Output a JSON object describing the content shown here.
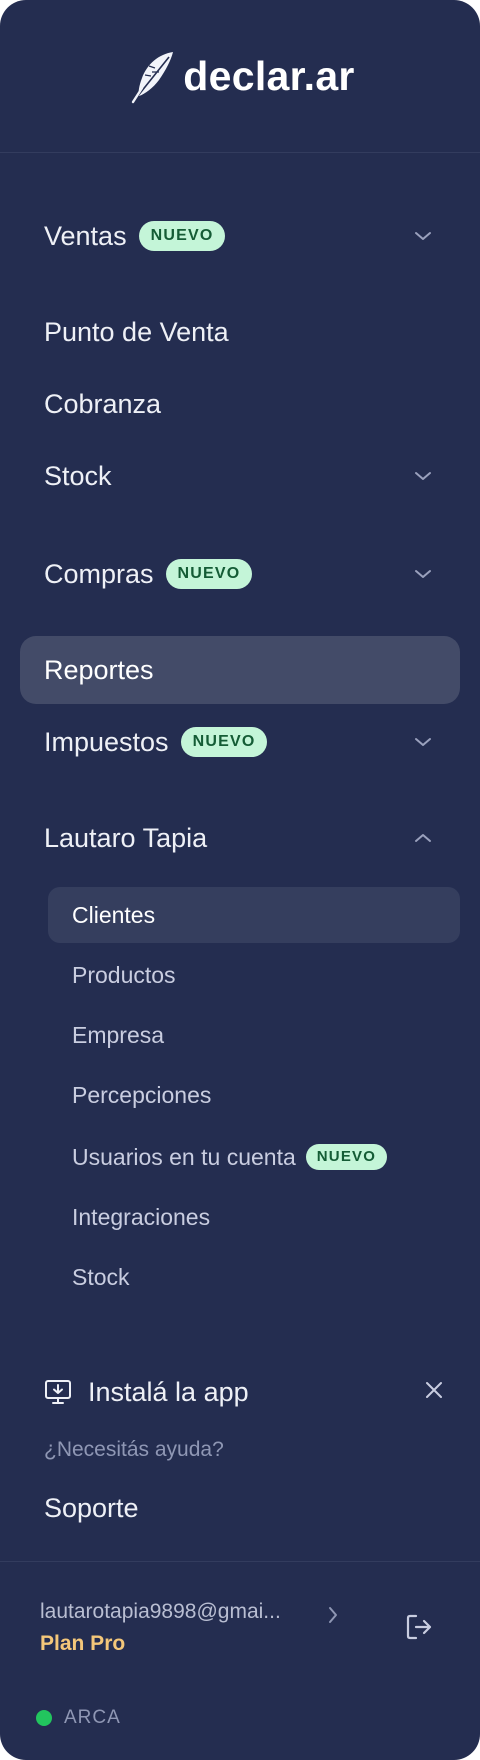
{
  "brand": {
    "name": "declar.ar",
    "logo_icon": "feather-icon"
  },
  "nav": {
    "ventas": {
      "label": "Ventas",
      "badge": "NUEVO"
    },
    "punto_de_venta": {
      "label": "Punto de Venta"
    },
    "cobranza": {
      "label": "Cobranza"
    },
    "stock": {
      "label": "Stock"
    },
    "compras": {
      "label": "Compras",
      "badge": "NUEVO"
    },
    "reportes": {
      "label": "Reportes"
    },
    "impuestos": {
      "label": "Impuestos",
      "badge": "NUEVO"
    },
    "account_section": {
      "label": "Lautaro Tapia"
    }
  },
  "submenu": {
    "clientes": "Clientes",
    "productos": "Productos",
    "empresa": "Empresa",
    "percepciones": "Percepciones",
    "usuarios": {
      "label": "Usuarios en tu cuenta",
      "badge": "NUEVO"
    },
    "integraciones": "Integraciones",
    "stock": "Stock"
  },
  "install": {
    "label": "Instalá la app",
    "icon": "monitor-download-icon"
  },
  "help": {
    "question": "¿Necesitás ayuda?",
    "support_label": "Soporte"
  },
  "account": {
    "email": "lautarotapia9898@gmai...",
    "plan": "Plan Pro"
  },
  "status": {
    "label": "ARCA",
    "color": "#22c55e"
  },
  "colors": {
    "sidebar_bg": "#242d50",
    "active_bg": "#434b68",
    "badge_bg": "#c4f5d8",
    "badge_text": "#145c35",
    "plan": "#f4c77a"
  }
}
